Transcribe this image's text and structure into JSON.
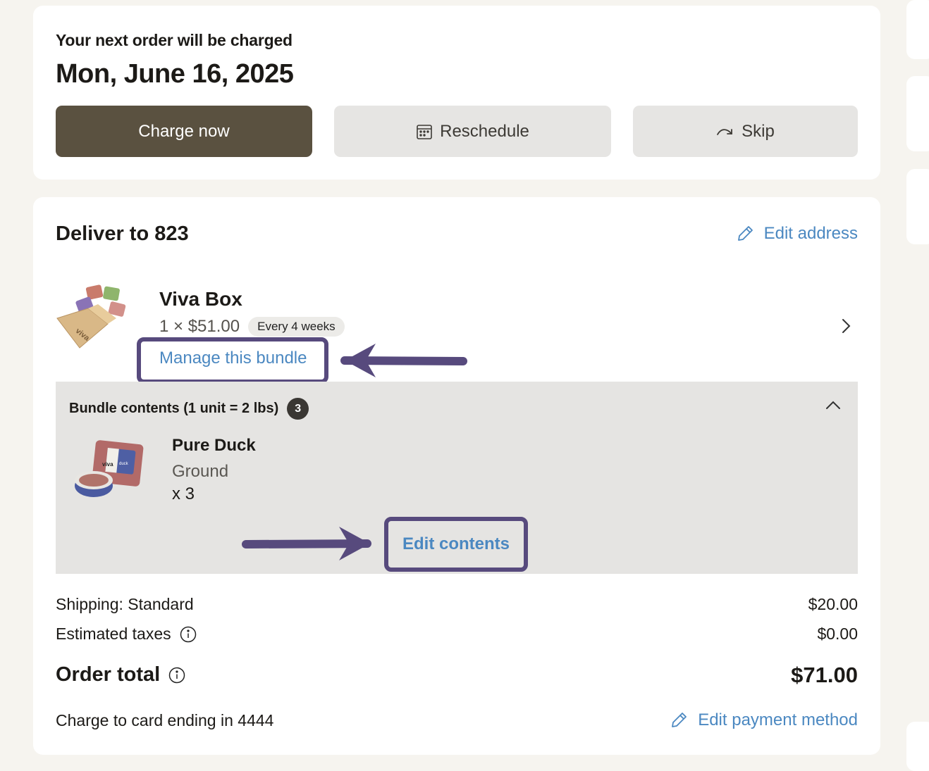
{
  "next_order": {
    "label": "Your next order will be charged",
    "date": "Mon, June 16, 2025"
  },
  "actions": {
    "charge_now": "Charge now",
    "reschedule": "Reschedule",
    "skip": "Skip"
  },
  "delivery": {
    "title": "Deliver to 823",
    "edit_address": "Edit address"
  },
  "product": {
    "title": "Viva Box",
    "price": "1 × $51.00",
    "frequency": "Every 4 weeks",
    "manage_link": "Manage this bundle",
    "image_alt": "viva"
  },
  "bundle": {
    "heading": "Bundle contents (1 unit = 2 lbs)",
    "count": "3",
    "item": {
      "name": "Pure Duck",
      "variant": "Ground",
      "quantity": "x 3",
      "package_text": "viva",
      "package_label": "duck"
    },
    "edit_contents": "Edit contents"
  },
  "summary": {
    "shipping_label": "Shipping: Standard",
    "shipping_value": "$20.00",
    "taxes_label": "Estimated taxes",
    "taxes_value": "$0.00",
    "total_label": "Order total",
    "total_value": "$71.00",
    "card_label": "Charge to card ending in 4444",
    "edit_payment": "Edit payment method"
  },
  "colors": {
    "primary_button": "#5a5140",
    "link": "#4b88c1",
    "annotation": "#574a7d",
    "page_bg": "#f6f4ef"
  },
  "icons": {
    "reschedule": "calendar-icon",
    "skip": "skip-arrow-icon",
    "edit": "pencil-icon",
    "info": "info-icon",
    "expand": "chevron-right-icon",
    "collapse": "chevron-up-icon"
  }
}
